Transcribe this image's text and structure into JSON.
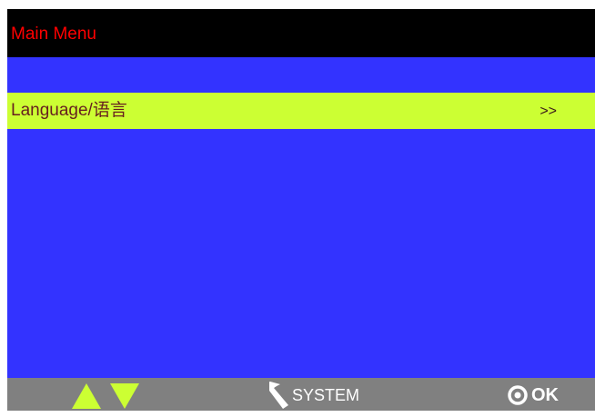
{
  "header": {
    "title": "Main Menu"
  },
  "menu": {
    "items": [
      {
        "label": "Language/语言",
        "arrow": ">>"
      }
    ]
  },
  "footer": {
    "up_icon": "up-triangle-icon",
    "down_icon": "down-triangle-icon",
    "system_icon": "back-arrow-icon",
    "system_label": "SYSTEM",
    "ok_icon": "target-circle-icon",
    "ok_label": "OK"
  },
  "colors": {
    "screen_background": "#3333ff",
    "title_bar": "#000000",
    "title_text": "#ff0000",
    "selected_item": "#ccff33",
    "bottom_bar": "#808080",
    "arrow_icons": "#ccff33"
  }
}
